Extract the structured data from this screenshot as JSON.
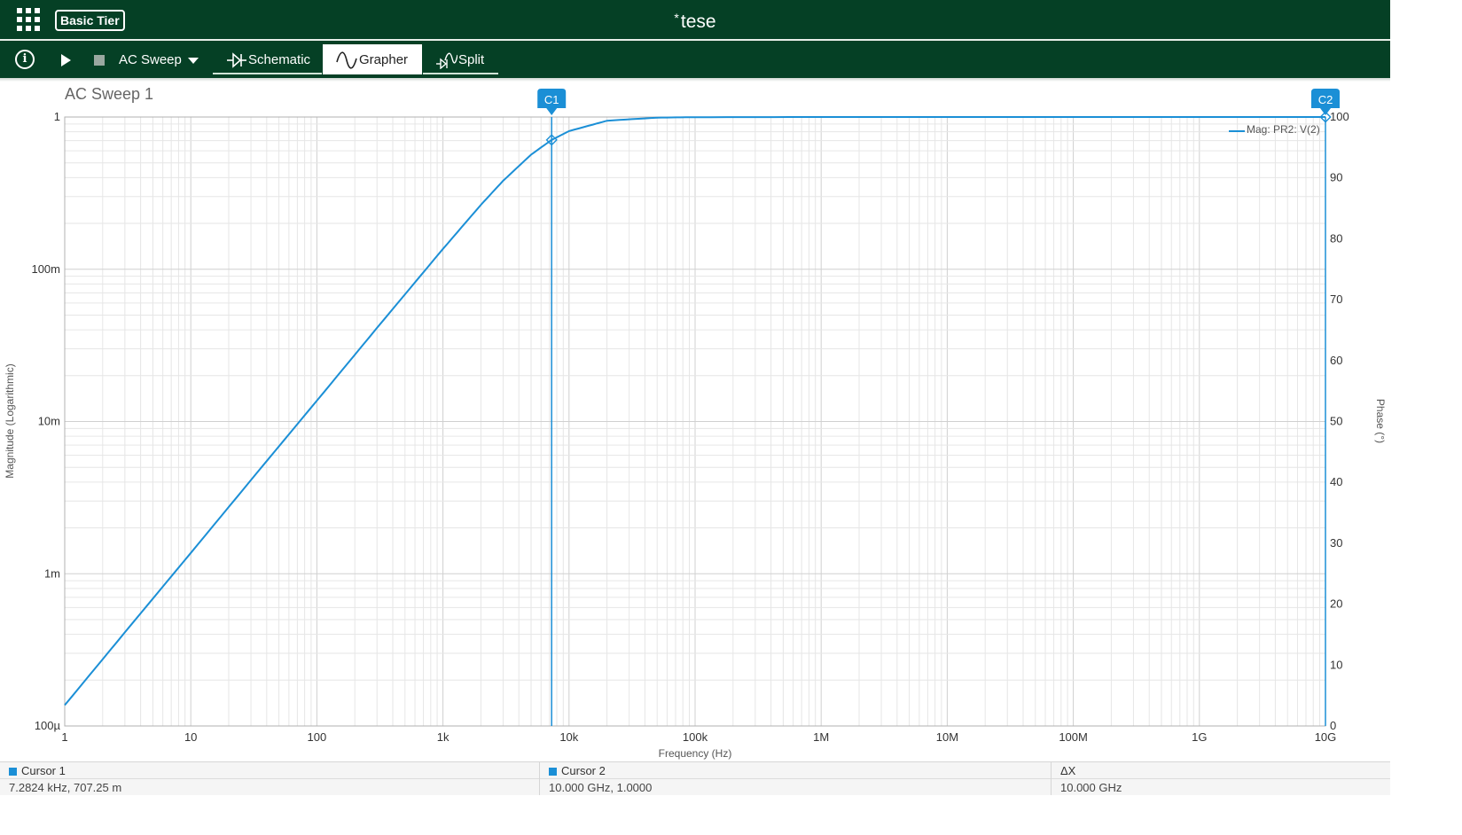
{
  "app": {
    "tier_label": "Basic Tier",
    "modified_marker": "*",
    "document_title": "tese"
  },
  "toolbar": {
    "info_glyph": "i",
    "analysis": "AC Sweep",
    "tabs": [
      {
        "label": "Schematic",
        "icon": "schematic-icon"
      },
      {
        "label": "Grapher",
        "icon": "sine-wave-icon",
        "active": true
      },
      {
        "label": "Split",
        "icon": "split-icon"
      }
    ]
  },
  "graph_title": "AC Sweep 1",
  "cursors": {
    "c1_label": "C1",
    "c2_label": "C2",
    "accent_color": "#1b8fd6"
  },
  "cursor_panel": {
    "cursor1": {
      "label": "Cursor 1",
      "value": "7.2824 kHz, 707.25 m"
    },
    "cursor2": {
      "label": "Cursor 2",
      "value": "10.000 GHz, 1.0000"
    },
    "delta": {
      "label": "ΔX",
      "value": "10.000 GHz"
    }
  },
  "chart_data": {
    "type": "line",
    "title": "AC Sweep 1",
    "xlabel": "Frequency (Hz)",
    "ylabel": "Magnitude (Logarithmic)",
    "y2label": "Phase (°)",
    "x_scale": "log",
    "y_scale": "log",
    "xlim": [
      1,
      10000000000
    ],
    "ylim": [
      0.0001,
      1
    ],
    "y2lim": [
      0,
      100
    ],
    "grid": true,
    "legend_position": "top-right",
    "x_ticks": [
      {
        "value": 1,
        "label": "1"
      },
      {
        "value": 10,
        "label": "10"
      },
      {
        "value": 100,
        "label": "100"
      },
      {
        "value": 1000,
        "label": "1k"
      },
      {
        "value": 10000,
        "label": "10k"
      },
      {
        "value": 100000,
        "label": "100k"
      },
      {
        "value": 1000000,
        "label": "1M"
      },
      {
        "value": 10000000,
        "label": "10M"
      },
      {
        "value": 100000000,
        "label": "100M"
      },
      {
        "value": 1000000000,
        "label": "1G"
      },
      {
        "value": 10000000000,
        "label": "10G"
      }
    ],
    "y_ticks": [
      {
        "value": 1,
        "label": "1"
      },
      {
        "value": 0.1,
        "label": "100m"
      },
      {
        "value": 0.01,
        "label": "10m"
      },
      {
        "value": 0.001,
        "label": "1m"
      },
      {
        "value": 0.0001,
        "label": "100µ"
      }
    ],
    "y2_ticks": [
      "0",
      "10",
      "20",
      "30",
      "40",
      "50",
      "60",
      "70",
      "80",
      "90",
      "100"
    ],
    "series": [
      {
        "name": "Mag: PR2: V(2)",
        "color": "#1b8fd6",
        "x": [
          1,
          3,
          10,
          30,
          100,
          300,
          1000,
          2000,
          3000,
          5000,
          7282.4,
          10000,
          20000,
          50000,
          100000,
          1000000,
          10000000,
          100000000,
          1000000000,
          10000000000
        ],
        "y": [
          0.000137,
          0.000412,
          0.00137,
          0.00412,
          0.0137,
          0.0412,
          0.136,
          0.265,
          0.381,
          0.566,
          0.70725,
          0.808,
          0.9454,
          0.9906,
          0.9976,
          1.0,
          1.0,
          1.0,
          1.0,
          1.0
        ]
      }
    ],
    "cursors": [
      {
        "name": "C1",
        "x": 7282.4,
        "y": 0.70725
      },
      {
        "name": "C2",
        "x": 10000000000,
        "y": 1.0
      }
    ]
  }
}
